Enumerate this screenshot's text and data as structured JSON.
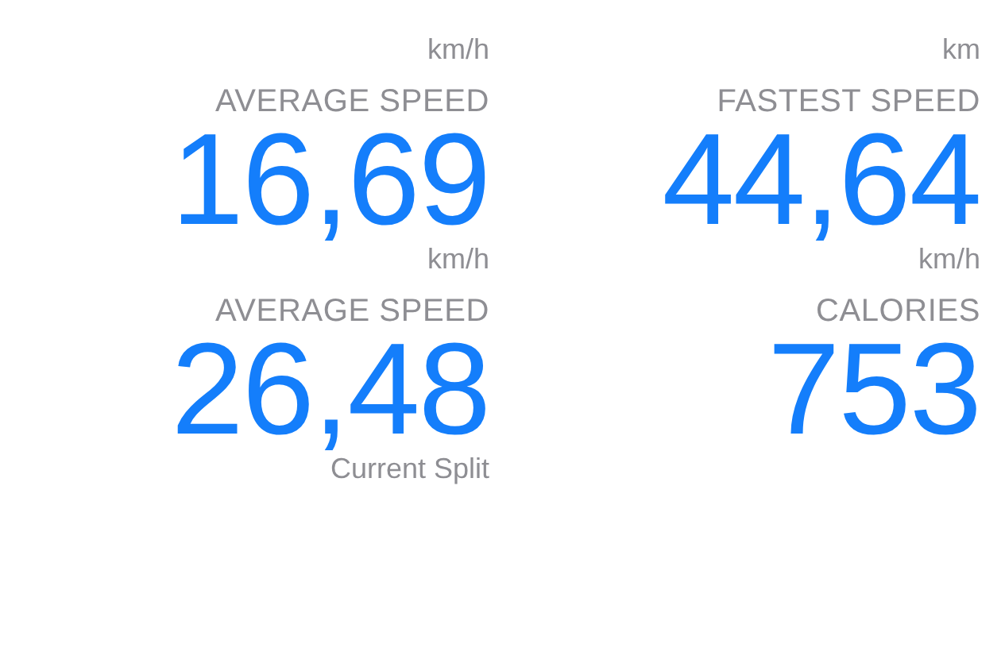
{
  "stats": [
    {
      "unit": "km/h"
    },
    {
      "unit": "km"
    },
    {
      "label": "AVERAGE SPEED",
      "value": "16,69",
      "unit": "km/h"
    },
    {
      "label": "FASTEST SPEED",
      "value": "44,64",
      "unit": "km/h"
    },
    {
      "label": "AVERAGE SPEED",
      "value": "26,48",
      "unit": "Current Split"
    },
    {
      "label": "CALORIES",
      "value": "753"
    }
  ]
}
